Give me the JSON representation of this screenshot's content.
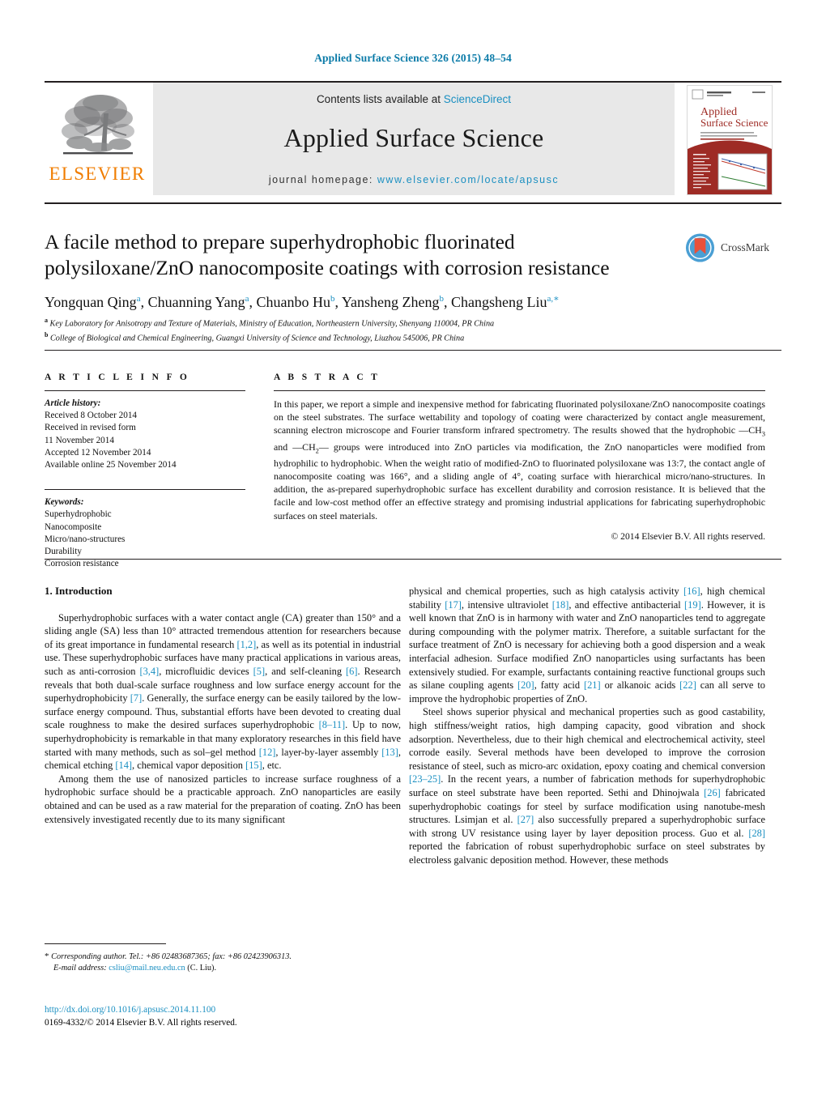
{
  "running_head": "Applied Surface Science 326 (2015) 48–54",
  "masthead": {
    "publisher_logo_name": "elsevier-tree-logo",
    "publisher_word": "ELSEVIER",
    "contents_prefix": "Contents lists available at ",
    "contents_link": "ScienceDirect",
    "journal_name": "Applied Surface Science",
    "homepage_prefix": "journal homepage: ",
    "homepage_url": "www.elsevier.com/locate/apsusc",
    "cover_title_line1": "Applied",
    "cover_title_line2": "Surface Science"
  },
  "crossmark": {
    "label": "CrossMark"
  },
  "article": {
    "title": "A facile method to prepare superhydrophobic fluorinated polysiloxane/ZnO nanocomposite coatings with corrosion resistance",
    "authors": [
      {
        "name": "Yongquan Qing",
        "sup": "a",
        "sep": ", "
      },
      {
        "name": "Chuanning Yang",
        "sup": "a",
        "sep": ", "
      },
      {
        "name": "Chuanbo Hu",
        "sup": "b",
        "sep": ", "
      },
      {
        "name": "Yansheng Zheng",
        "sup": "b",
        "sep": ", "
      },
      {
        "name": "Changsheng Liu",
        "sup": "a,",
        "sep": ""
      }
    ],
    "affiliations": [
      {
        "marker": "a",
        "text": "Key Laboratory for Anisotropy and Texture of Materials, Ministry of Education, Northeastern University, Shenyang 110004, PR China"
      },
      {
        "marker": "b",
        "text": "College of Biological and Chemical Engineering, Guangxi University of Science and Technology, Liuzhou 545006, PR China"
      }
    ]
  },
  "article_info": {
    "heading": "A R T I C L E   I N F O",
    "history_label": "Article history:",
    "history": [
      "Received 8 October 2014",
      "Received in revised form",
      "11 November 2014",
      "Accepted 12 November 2014",
      "Available online 25 November 2014"
    ],
    "keywords_label": "Keywords:",
    "keywords": [
      "Superhydrophobic",
      "Nanocomposite",
      "Micro/nano-structures",
      "Durability",
      "Corrosion resistance"
    ]
  },
  "abstract": {
    "heading": "A B S T R A C T",
    "paragraph_part1": "In this paper, we report a simple and inexpensive method for fabricating fluorinated polysiloxane/ZnO nanocomposite coatings on the steel substrates. The surface wettability and topology of coating were characterized by contact angle measurement, scanning electron microscope and Fourier transform infrared spectrometry. The results showed that the hydrophobic —CH",
    "sub1": "3",
    "paragraph_part2": " and —CH",
    "sub2": "2",
    "paragraph_part3": "— groups were introduced into ZnO particles via modification, the ZnO nanoparticles were modified from hydrophilic to hydrophobic. When the weight ratio of modified-ZnO to fluorinated polysiloxane was 13:7, the contact angle of nanocomposite coating was 166°, and a sliding angle of 4°, coating surface with hierarchical micro/nano-structures. In addition, the as-prepared superhydrophobic surface has excellent durability and corrosion resistance. It is believed that the facile and low-cost method offer an effective strategy and promising industrial applications for fabricating superhydrophobic surfaces on steel materials.",
    "copyright": "© 2014 Elsevier B.V. All rights reserved."
  },
  "body": {
    "section_number_title": "1.  Introduction",
    "left_paragraph_1": {
      "t1": "Superhydrophobic surfaces with a water contact angle (CA) greater than 150° and a sliding angle (SA) less than 10° attracted tremendous attention for researchers because of its great importance in fundamental research ",
      "r1": "[1,2]",
      "t2": ", as well as its potential in industrial use. These superhydrophobic surfaces have many practical applications in various areas, such as anti-corrosion ",
      "r2": "[3,4]",
      "t3": ", microfluidic devices ",
      "r3": "[5]",
      "t4": ", and self-cleaning ",
      "r4": "[6]",
      "t5": ". Research reveals that both dual-scale surface roughness and low surface energy account for the superhydrophobicity ",
      "r5": "[7]",
      "t6": ". Generally, the surface energy can be easily tailored by the low-surface energy compound. Thus, substantial efforts have been devoted to creating dual scale roughness to make the desired surfaces superhydrophobic ",
      "r6": "[8–11]",
      "t7": ". Up to now, superhydrophobicity is remarkable in that many exploratory researches in this field have started with many methods, such as sol–gel method ",
      "r7": "[12]",
      "t8": ", layer-by-layer assembly ",
      "r8": "[13]",
      "t9": ", chemical etching ",
      "r9": "[14]",
      "t10": ", chemical vapor deposition ",
      "r10": "[15]",
      "t11": ", etc."
    },
    "left_paragraph_2": {
      "t1": "Among them the use of nanosized particles to increase surface roughness of a hydrophobic surface should be a practicable approach. ZnO nanoparticles are easily obtained and can be used as a raw material for the preparation of coating. ZnO has been extensively investigated recently due to its many significant"
    },
    "right_paragraph_1": {
      "t1": "physical and chemical properties, such as high catalysis activity ",
      "r1": "[16]",
      "t2": ", high chemical stability ",
      "r2": "[17]",
      "t3": ", intensive ultraviolet ",
      "r3": "[18]",
      "t4": ", and effective antibacterial ",
      "r4": "[19]",
      "t5": ". However, it is well known that ZnO is in harmony with water and ZnO nanoparticles tend to aggregate during compounding with the polymer matrix. Therefore, a suitable surfactant for the surface treatment of ZnO is necessary for achieving both a good dispersion and a weak interfacial adhesion. Surface modified ZnO nanoparticles using surfactants has been extensively studied. For example, surfactants containing reactive functional groups such as silane coupling agents ",
      "r5": "[20]",
      "t6": ", fatty acid ",
      "r6": "[21]",
      "t7": " or alkanoic acids ",
      "r7": "[22]",
      "t8": " can all serve to improve the hydrophobic properties of ZnO."
    },
    "right_paragraph_2": {
      "t1": "Steel shows superior physical and mechanical properties such as good castability, high stiffness/weight ratios, high damping capacity, good vibration and shock adsorption. Nevertheless, due to their high chemical and electrochemical activity, steel corrode easily. Several methods have been developed to improve the corrosion resistance of steel, such as micro-arc oxidation, epoxy coating and chemical conversion ",
      "r1": "[23–25]",
      "t2": ". In the recent years, a number of fabrication methods for superhydrophobic surface on steel substrate have been reported. Sethi and Dhinojwala ",
      "r2": "[26]",
      "t3": " fabricated superhydrophobic coatings for steel by surface modification using nanotube-mesh structures. Lsimjan et al. ",
      "r3": "[27]",
      "t4": " also successfully prepared a superhydrophobic surface with strong UV resistance using layer by layer deposition process. Guo et al. ",
      "r4": "[28]",
      "t5": " reported the fabrication of robust superhydrophobic surface on steel substrates by electroless galvanic deposition method. However, these methods"
    }
  },
  "footnotes": {
    "star": "*",
    "corresponding": "Corresponding author. Tel.: +86 02483687365; fax: +86 02423906313.",
    "email_label": "E-mail address:",
    "email": "csliu@mail.neu.edu.cn",
    "email_suffix": "(C. Liu).",
    "doi": "http://dx.doi.org/10.1016/j.apsusc.2014.11.100",
    "issn_copyright": "0169-4332/© 2014 Elsevier B.V. All rights reserved."
  },
  "colors": {
    "link_blue": "#1a8fc1",
    "running_head_blue": "#0b7ba8",
    "elsevier_orange": "#f07d00",
    "masthead_grey": "#e8e8e8",
    "cover_red": "#9e2b25",
    "crossmark_blue": "#4a9fd4",
    "crossmark_red": "#e8503a"
  }
}
